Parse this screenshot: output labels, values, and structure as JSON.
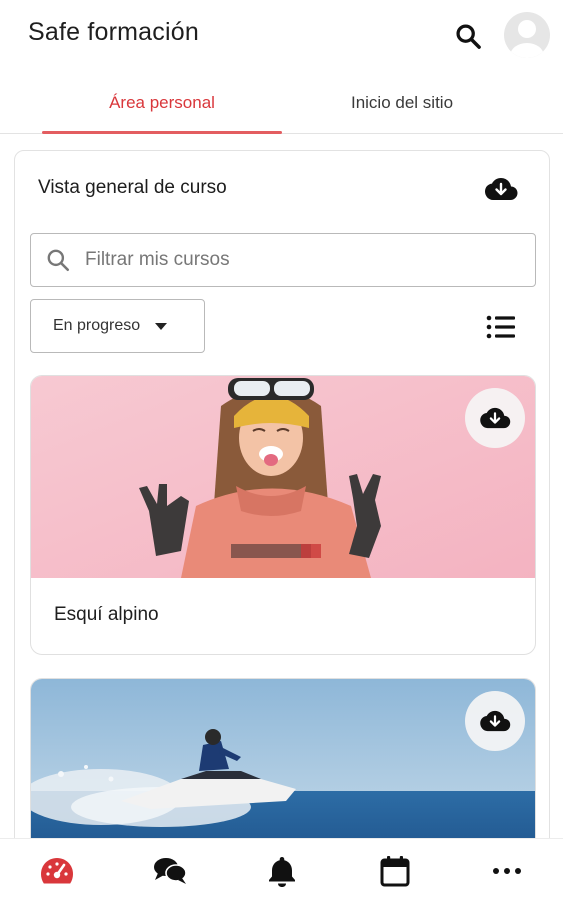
{
  "app": {
    "title": "Safe formación"
  },
  "tabs": [
    {
      "label": "Área personal",
      "active": true
    },
    {
      "label": "Inicio del sitio",
      "active": false
    }
  ],
  "overview": {
    "title": "Vista general de curso",
    "filter": {
      "placeholder": "Filtrar mis cursos",
      "value": ""
    },
    "status_select": {
      "selected": "En progreso"
    }
  },
  "courses": [
    {
      "name": "Esquí alpino",
      "image": "skier-woman-pink-background"
    },
    {
      "name": "",
      "image": "jet-ski-on-sea"
    }
  ],
  "bottom_nav": [
    {
      "icon": "dashboard-gauge-icon",
      "active": true
    },
    {
      "icon": "messages-icon",
      "active": false
    },
    {
      "icon": "notifications-bell-icon",
      "active": false
    },
    {
      "icon": "calendar-icon",
      "active": false
    },
    {
      "icon": "more-icon",
      "active": false
    }
  ],
  "colors": {
    "accent": "#d9373b",
    "tab_indicator": "#e35d60",
    "border": "#b9b9b9"
  }
}
